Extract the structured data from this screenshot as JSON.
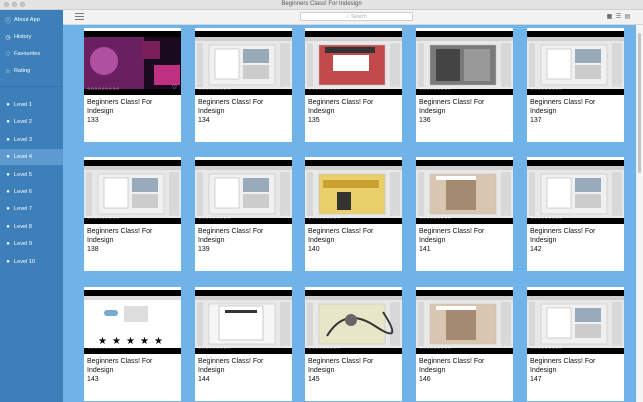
{
  "window": {
    "title": "Beginners Class! For Indesign"
  },
  "sidebar": {
    "top_items": [
      {
        "label": "About App",
        "icon": "info-icon"
      },
      {
        "label": "History",
        "icon": "clock-icon"
      },
      {
        "label": "Favourites",
        "icon": "heart-icon"
      },
      {
        "label": "Rating",
        "icon": "star-icon"
      }
    ],
    "levels": [
      {
        "label": "Level 1"
      },
      {
        "label": "Level 2"
      },
      {
        "label": "Level 3"
      },
      {
        "label": "Level 4",
        "active": true
      },
      {
        "label": "Level 5"
      },
      {
        "label": "Level 6"
      },
      {
        "label": "Level 7"
      },
      {
        "label": "Level 8"
      },
      {
        "label": "Level 9"
      },
      {
        "label": "Level 10"
      }
    ]
  },
  "toolbar": {
    "search_placeholder": "Search"
  },
  "cards": [
    {
      "title": "Beginners Class! For Indesign",
      "number": "133",
      "thumb": "course-cover"
    },
    {
      "title": "Beginners Class! For Indesign",
      "number": "134",
      "thumb": "app"
    },
    {
      "title": "Beginners Class! For Indesign",
      "number": "135",
      "thumb": "app-red"
    },
    {
      "title": "Beginners Class! For Indesign",
      "number": "136",
      "thumb": "app-dark"
    },
    {
      "title": "Beginners Class! For Indesign",
      "number": "137",
      "thumb": "app"
    },
    {
      "title": "Beginners Class! For Indesign",
      "number": "138",
      "thumb": "app"
    },
    {
      "title": "Beginners Class! For Indesign",
      "number": "139",
      "thumb": "app"
    },
    {
      "title": "Beginners Class! For Indesign",
      "number": "140",
      "thumb": "app-yellow"
    },
    {
      "title": "Beginners Class! For Indesign",
      "number": "141",
      "thumb": "app-photo"
    },
    {
      "title": "Beginners Class! For Indesign",
      "number": "142",
      "thumb": "app"
    },
    {
      "title": "Beginners Class! For Indesign",
      "number": "143",
      "thumb": "app-stars"
    },
    {
      "title": "Beginners Class! For Indesign",
      "number": "144",
      "thumb": "app-doc"
    },
    {
      "title": "Beginners Class! For Indesign",
      "number": "145",
      "thumb": "app-sketch"
    },
    {
      "title": "Beginners Class! For Indesign",
      "number": "146",
      "thumb": "app-photo"
    },
    {
      "title": "Beginners Class! For Indesign",
      "number": "147",
      "thumb": "app"
    }
  ],
  "colors": {
    "sidebar": "#3d7fb8",
    "sidebar_active": "#5c9ad0",
    "content_bg": "#6fb3e8"
  }
}
